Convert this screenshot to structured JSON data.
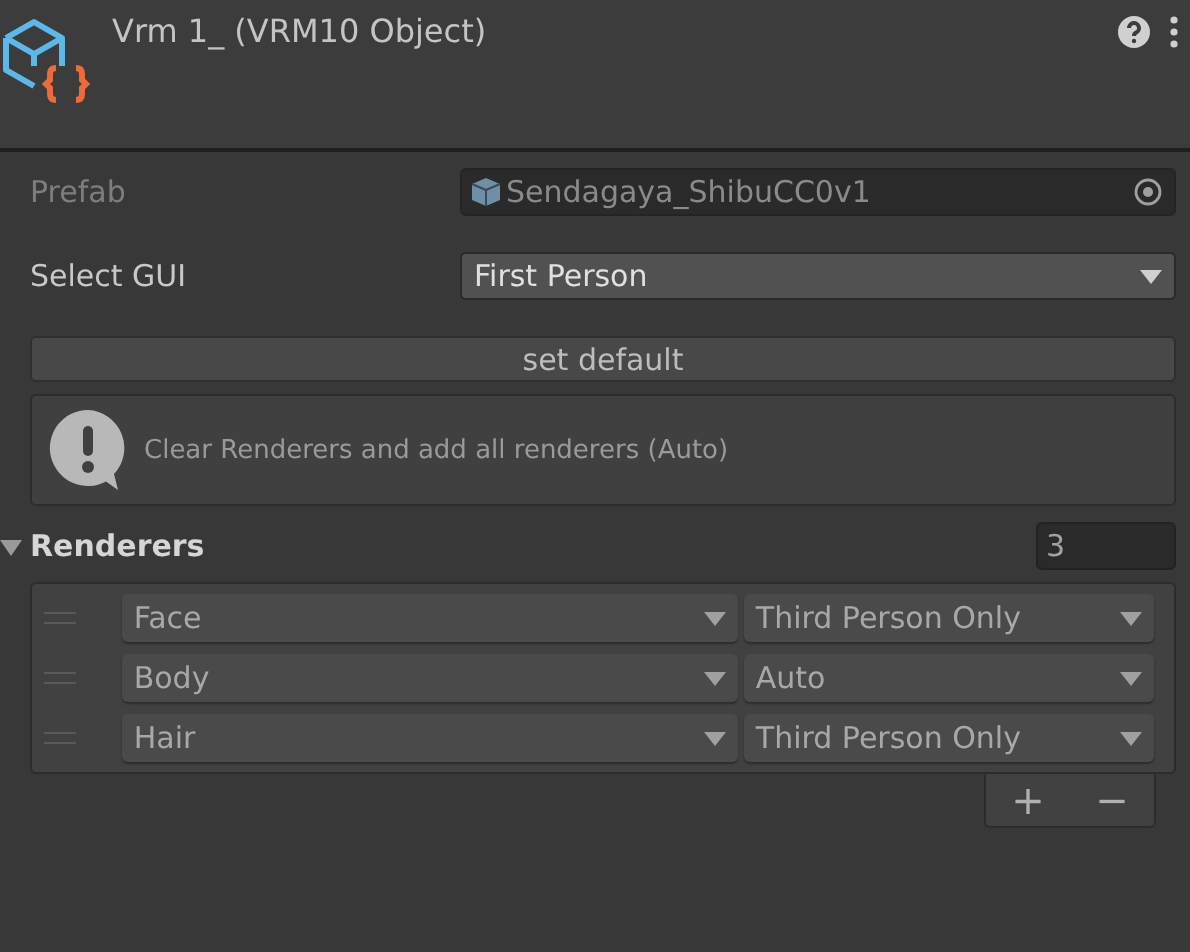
{
  "header": {
    "title": "Vrm 1_ (VRM10 Object)"
  },
  "fields": [
    {
      "kind": "object",
      "label": "Prefab",
      "value": "Sendagaya_ShibuCC0v1",
      "disabled": true
    },
    {
      "kind": "popup",
      "label": "Select GUI",
      "value": "First Person",
      "disabled": false
    }
  ],
  "button": "set default",
  "help_box": {
    "message": "Clear Renderers and add all renderers (Auto)"
  },
  "renderers": {
    "label": "Renderers",
    "expanded": true,
    "count": "3",
    "items": [
      {
        "renderer": "Face",
        "mode": "Third Person Only"
      },
      {
        "renderer": "Body",
        "mode": "Auto"
      },
      {
        "renderer": "Hair",
        "mode": "Third Person Only"
      }
    ],
    "footer": [
      "+",
      "−"
    ]
  }
}
